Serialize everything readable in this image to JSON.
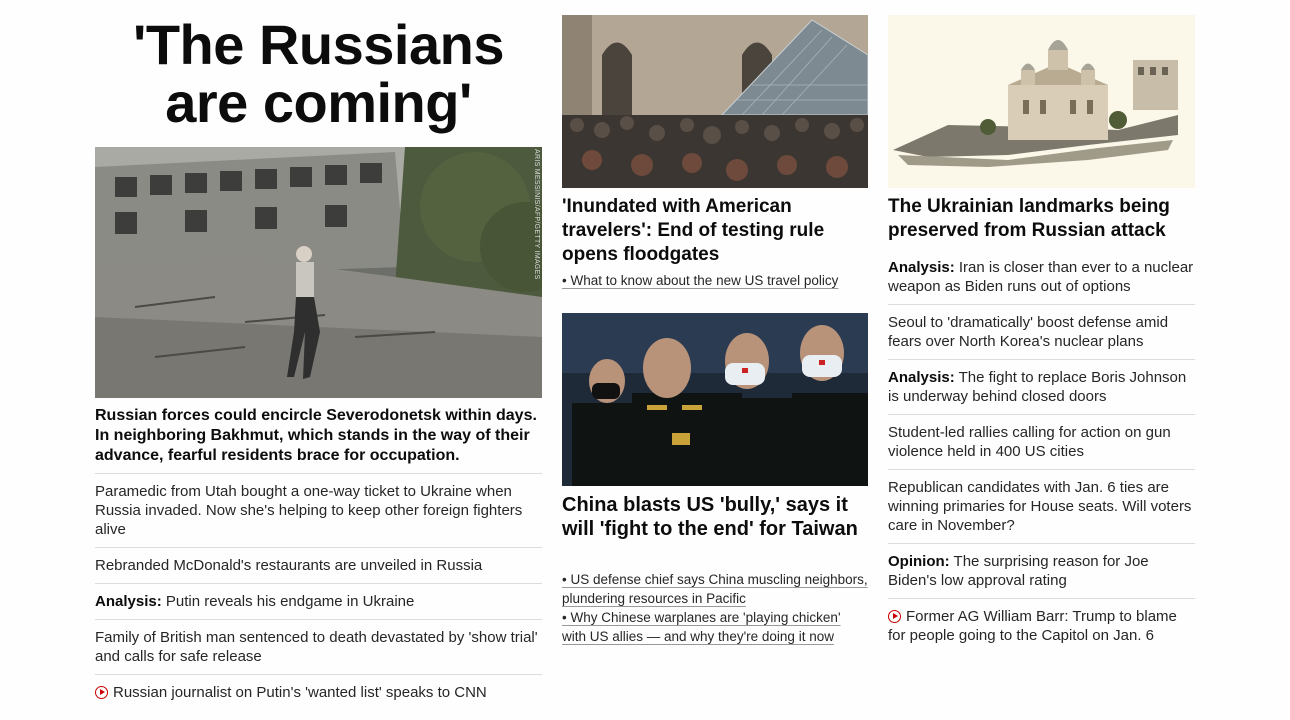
{
  "column1": {
    "title": "'The Russians are coming'",
    "photo_credit": "ARIS MESSINIS/AFP/GETTY IMAGES",
    "lead_headline": "Russian forces could encircle Severodonetsk within days. In neighboring Bakhmut, which stands in the way of their advance, fearful residents brace for occupation.",
    "stories": [
      {
        "prefix": "",
        "text": "Paramedic from Utah bought a one-way ticket to Ukraine when Russia invaded. Now she's helping to keep other foreign fighters alive",
        "video": false
      },
      {
        "prefix": "",
        "text": "Rebranded McDonald's restaurants are unveiled in Russia",
        "video": false
      },
      {
        "prefix": "Analysis:",
        "text": " Putin reveals his endgame in Ukraine",
        "video": false
      },
      {
        "prefix": "",
        "text": "Family of British man sentenced to death devastated by 'show trial' and calls for safe release",
        "video": false
      },
      {
        "prefix": "",
        "text": "Russian journalist on Putin's 'wanted list' speaks to CNN",
        "video": true
      }
    ]
  },
  "column2": {
    "card1": {
      "headline": "'Inundated with American travelers': End of testing rule opens floodgates",
      "bullets": [
        "• What to know about the new US travel policy"
      ]
    },
    "card2": {
      "headline": "China blasts US 'bully,' says it will 'fight to the end' for Taiwan",
      "bullets": [
        "• US defense chief says China muscling neighbors, plundering resources in Pacific",
        "• Why Chinese warplanes are 'playing chicken' with US allies — and why they're doing it now"
      ]
    }
  },
  "column3": {
    "headline": "The Ukrainian landmarks being preserved from Russian attack",
    "stories": [
      {
        "prefix": "Analysis:",
        "text": " Iran is closer than ever to a nuclear weapon as Biden runs out of options",
        "video": false
      },
      {
        "prefix": "",
        "text": "Seoul to 'dramatically' boost defense amid fears over North Korea's nuclear plans",
        "video": false
      },
      {
        "prefix": "Analysis:",
        "text": " The fight to replace Boris Johnson is underway behind closed doors",
        "video": false
      },
      {
        "prefix": "",
        "text": "Student-led rallies calling for action on gun violence held in 400 US cities",
        "video": false
      },
      {
        "prefix": "",
        "text": "Republican candidates with Jan. 6 ties are winning primaries for House seats. Will voters care in November?",
        "video": false
      },
      {
        "prefix": "Opinion:",
        "text": " The surprising reason for Joe Biden's low approval rating",
        "video": false
      },
      {
        "prefix": "",
        "text": "Former AG William Barr: Trump to blame for people going to the Capitol on Jan. 6",
        "video": true
      }
    ]
  }
}
